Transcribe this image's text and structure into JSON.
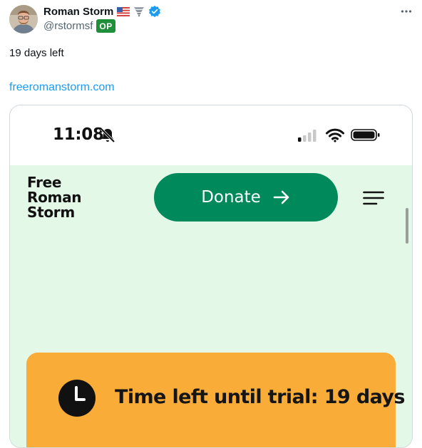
{
  "post": {
    "author_name": "Roman Storm",
    "handle": "@rstormsf",
    "op_badge": "OP",
    "text": "19 days left",
    "link": "freeromanstorm.com"
  },
  "icons": {
    "flag": "us-flag-icon",
    "emoji": "tornado-icon",
    "verified": "verified-badge-icon",
    "more": "more-options-icon"
  },
  "screenshot": {
    "status_time": "11:08",
    "site": {
      "logo_lines": [
        "Free",
        "Roman",
        "Storm"
      ],
      "donate_label": "Donate",
      "banner_text": "Time left until trial: 19 days"
    }
  },
  "colors": {
    "link": "#1d9bf0",
    "op_badge": "#1f8f3a",
    "site_background": "#e3f8e6",
    "donate_button": "#008a5c",
    "banner": "#f9ac37"
  }
}
